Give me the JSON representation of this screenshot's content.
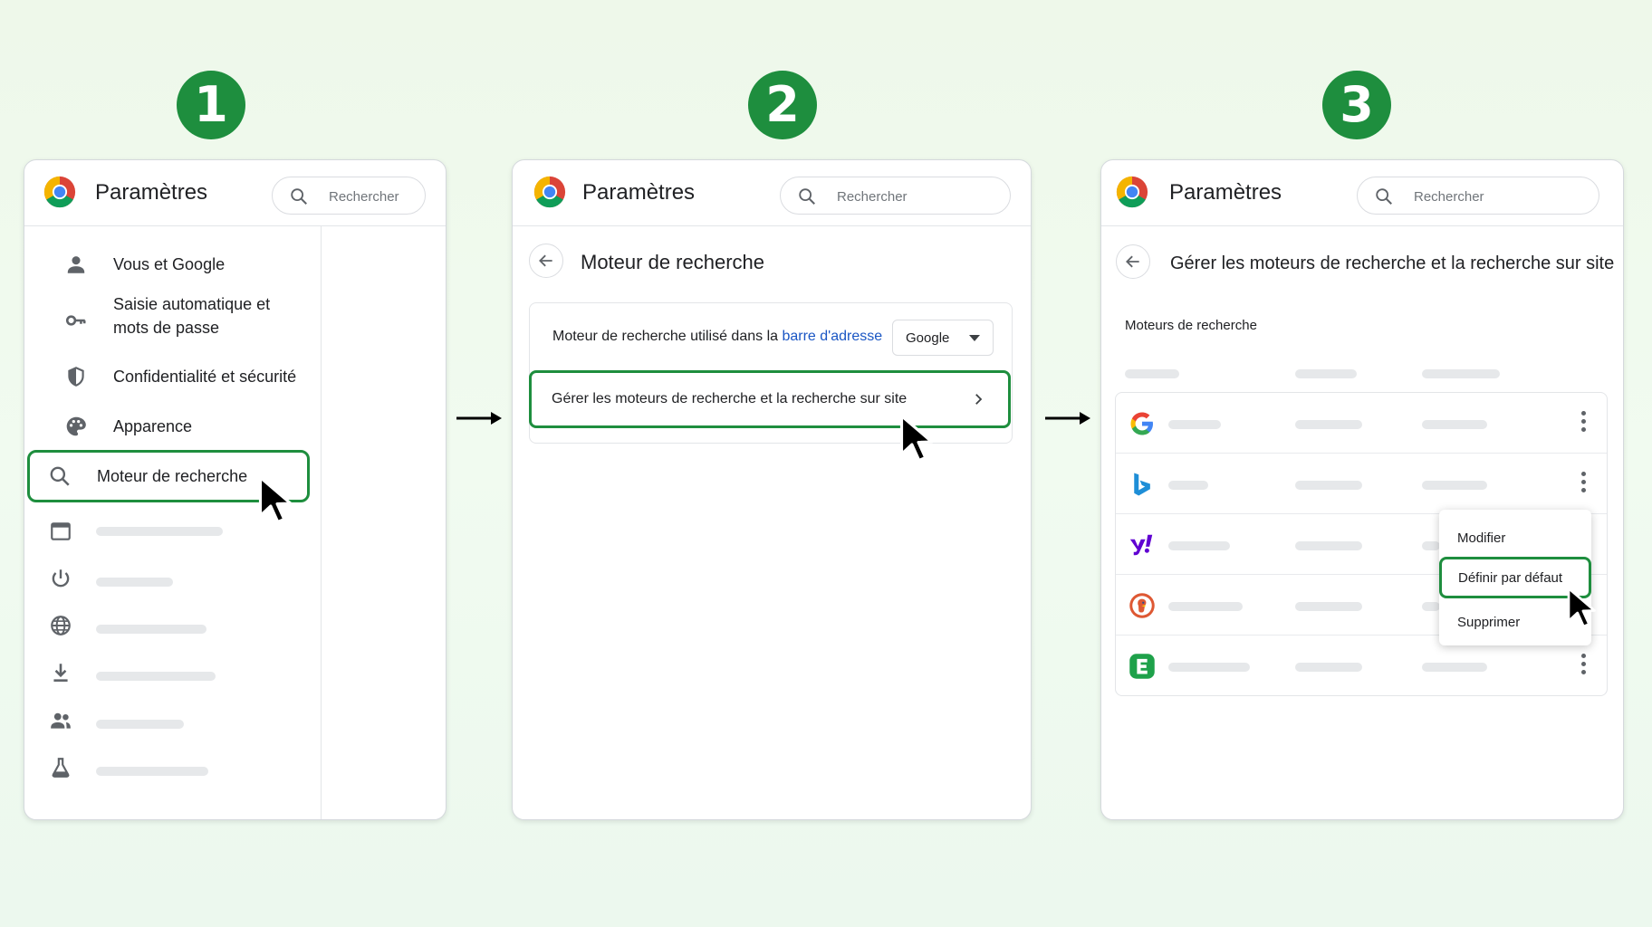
{
  "steps": [
    "1",
    "2",
    "3"
  ],
  "panel1": {
    "title": "Paramètres",
    "search_placeholder": "Rechercher",
    "menu": [
      {
        "icon": "person-icon",
        "label": "Vous et Google"
      },
      {
        "icon": "key-icon",
        "label": "Saisie automatique et\nmots de passe"
      },
      {
        "icon": "shield-icon",
        "label": "Confidentialité et sécurité"
      },
      {
        "icon": "palette-icon",
        "label": "Apparence"
      },
      {
        "icon": "search-icon",
        "label": "Moteur de recherche",
        "highlighted": true
      }
    ],
    "placeholder_items": [
      "browser-window-icon",
      "power-icon",
      "globe-icon",
      "download-icon",
      "people-icon",
      "flask-icon"
    ]
  },
  "panel2": {
    "title": "Paramètres",
    "search_placeholder": "Rechercher",
    "subpage_title": "Moteur de recherche",
    "default_engine_text": "Moteur de recherche utilisé dans la ",
    "default_engine_link": "barre d'adresse",
    "default_engine_value": "Google",
    "manage_label": "Gérer les moteurs de recherche et la recherche sur site"
  },
  "panel3": {
    "title": "Paramètres",
    "search_placeholder": "Rechercher",
    "subpage_title": "Gérer les moteurs de recherche et la recherche sur site",
    "section_label": "Moteurs de recherche",
    "engines": [
      "google-logo",
      "bing-logo",
      "yahoo-logo",
      "duckduckgo-logo",
      "ecosia-logo"
    ],
    "context_menu": [
      "Modifier",
      "Définir par défaut",
      "Supprimer"
    ],
    "highlighted_menu_item": "Définir par défaut"
  },
  "colors": {
    "accent_green": "#1e8e3e",
    "highlight_border": "#1e8e3e",
    "link_blue": "#1a56c4"
  }
}
